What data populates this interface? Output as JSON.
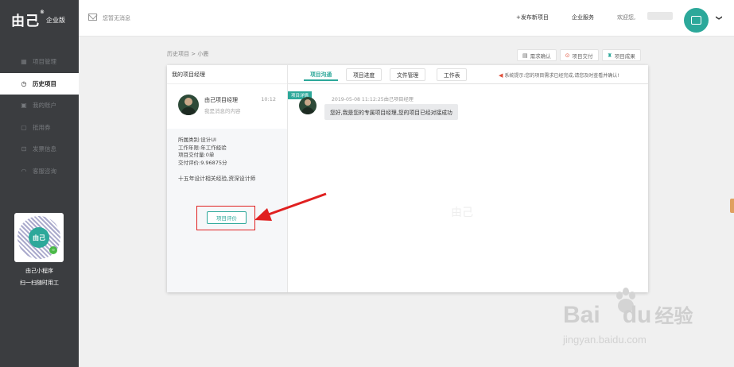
{
  "sidebar": {
    "logo": "由己",
    "logo_mark": "®",
    "logo_sub": "企业版",
    "items": [
      {
        "label": "项目管理",
        "icon": "grid-icon"
      },
      {
        "label": "历史项目",
        "icon": "history-icon",
        "active": true
      },
      {
        "label": "我的账户",
        "icon": "account-icon"
      },
      {
        "label": "抵用券",
        "icon": "coupon-icon"
      },
      {
        "label": "发票信息",
        "icon": "invoice-icon"
      },
      {
        "label": "客服咨询",
        "icon": "headset-icon"
      }
    ],
    "qr": {
      "center_text": "由己",
      "label": "由己小程序",
      "sub_label": "扫一扫随时用工"
    }
  },
  "topbar": {
    "message": "您暂无消息",
    "post_project": "+发布新项目",
    "enterprise_service": "企业服务",
    "welcome": "欢迎您,",
    "caret": "❯"
  },
  "breadcrumb": "历史项目 > 小鹿",
  "actions": [
    {
      "label": "需求确认",
      "icon": "calendar-icon"
    },
    {
      "label": "项目交付",
      "icon": "delivery-icon"
    },
    {
      "label": "项目成果",
      "icon": "trophy-icon"
    }
  ],
  "panel": {
    "title": "我的项目经理",
    "contact": {
      "name": "由己项目经理",
      "time": "10:12",
      "subtitle": "我是消息的内容"
    },
    "info": [
      "所属类别:设计UI",
      "工作年限:年工作经验",
      "项目交付量:0单",
      "交付评价:9.96875分"
    ],
    "description": "十五年设计相关经验,资深设计师",
    "evaluate_button": "项目评价"
  },
  "tabs": [
    {
      "label": "项目沟通",
      "active": true
    },
    {
      "label": "项目进度"
    },
    {
      "label": "文件管理"
    },
    {
      "label": "工作表"
    }
  ],
  "system_tip": "系统提示:您的项目需求已经完成,请您及时查看并确认!",
  "chat": {
    "tag": "项目详情",
    "meta": "2019-05-08 11:12:25由己项目经理",
    "message": "您好,我是您的专属项目经理,您的项目已经对接成功",
    "center_mark": "由己"
  },
  "watermark": {
    "brand": "Bai",
    "brand_tail": "du",
    "cn": "经验",
    "url": "jingyan.baidu.com"
  },
  "colors": {
    "accent": "#2ca89a",
    "sidebar_bg": "#3b3d40",
    "highlight_red": "#e02020"
  }
}
